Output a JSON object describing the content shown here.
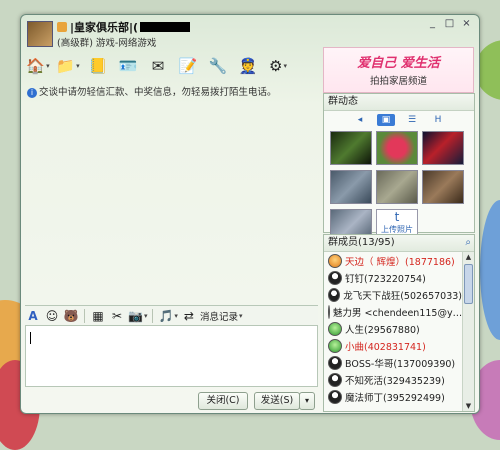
{
  "window": {
    "title": "|皇家俱乐部|(",
    "subtitle": "(高级群) 游戏-网络游戏",
    "controls": [
      "_",
      "□",
      "×"
    ]
  },
  "toolbar": {
    "buttons": [
      {
        "name": "home",
        "icon": "🏠"
      },
      {
        "name": "folder",
        "icon": "📁"
      },
      {
        "name": "notes",
        "icon": "📒"
      },
      {
        "name": "card",
        "icon": "🪪"
      },
      {
        "name": "mail",
        "icon": "✉"
      },
      {
        "name": "edit",
        "icon": "📝"
      },
      {
        "name": "tools",
        "icon": "🔧"
      },
      {
        "name": "admin",
        "icon": "👮"
      },
      {
        "name": "settings",
        "icon": "⚙"
      }
    ]
  },
  "banner": {
    "title": "爱自己 爱生活",
    "subtitle": "拍拍家居频道"
  },
  "chat": {
    "notice": "交谈中请勿轻信汇款、中奖信息，勿轻易拨打陌生电话。"
  },
  "format_bar": {
    "items": [
      "A",
      "☺",
      "🐻",
      "▦",
      "✂",
      "📷",
      "🎵",
      "⇄"
    ],
    "message_record": "消息记录"
  },
  "buttons": {
    "close": "关闭(C)",
    "send": "发送(S)",
    "send_dropdown": "▾"
  },
  "dynamics": {
    "header": "群动态",
    "view_tabs": [
      "◂",
      "▣",
      "☰",
      "H"
    ],
    "upload": "上传照片"
  },
  "members": {
    "header": "群成员(13/95)",
    "list": [
      {
        "name": "天边（ 辉煌）(1877186)",
        "red": true
      },
      {
        "name": "钉钉(723220754)",
        "red": false
      },
      {
        "name": "龙飞天下战狂(502657033)",
        "red": false
      },
      {
        "name": "魅力男 <chendeen115@y…",
        "red": false
      },
      {
        "name": "人生(29567880)",
        "red": false
      },
      {
        "name": "小曲(402831741)",
        "red": true
      },
      {
        "name": "BOSS-华哥(137009390)",
        "red": false
      },
      {
        "name": "不知死活(329435239)",
        "red": false
      },
      {
        "name": "魔法师丁(395292499)",
        "red": false
      }
    ]
  },
  "colors": {
    "accent": "#3a7bd5",
    "banner_pink": "#e0306f",
    "member_red": "#d4261f"
  }
}
